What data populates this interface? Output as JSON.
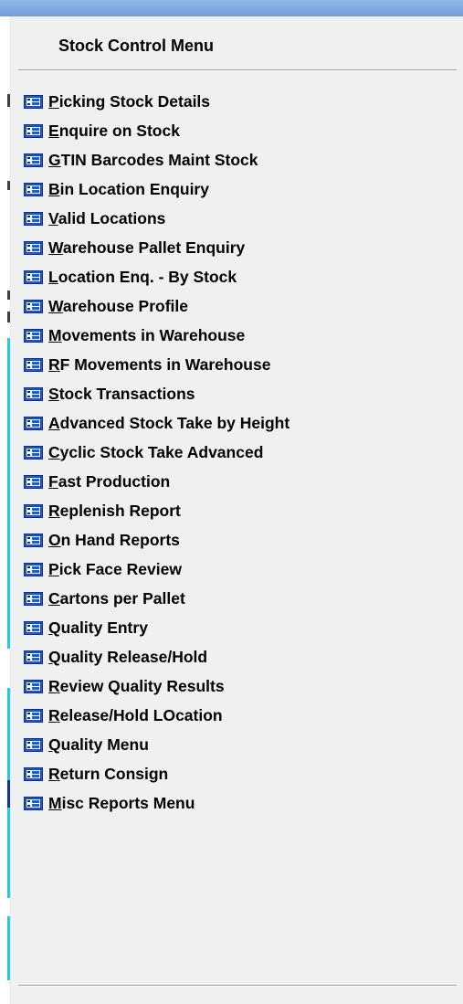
{
  "window": {
    "title_color": "#7aa7dd"
  },
  "menu": {
    "title": "Stock Control Menu",
    "icon": "menu-form-icon",
    "icon_colors": {
      "fill": "#1f5fbf",
      "frame": "#0b2f7a",
      "inner": "#ffffff"
    },
    "items": [
      {
        "first": "P",
        "rest": "icking Stock Details"
      },
      {
        "first": "E",
        "rest": "nquire on Stock"
      },
      {
        "first": "G",
        "rest": "TIN Barcodes Maint Stock"
      },
      {
        "first": "B",
        "rest": "in Location Enquiry"
      },
      {
        "first": "V",
        "rest": "alid Locations"
      },
      {
        "first": "W",
        "rest": "arehouse Pallet Enquiry"
      },
      {
        "first": "L",
        "rest": "ocation Enq. - By Stock"
      },
      {
        "first": "W",
        "rest": "arehouse Profile"
      },
      {
        "first": "M",
        "rest": "ovements in Warehouse"
      },
      {
        "first": "R",
        "rest": "F Movements in Warehouse"
      },
      {
        "first": "S",
        "rest": "tock Transactions"
      },
      {
        "first": "A",
        "rest": "dvanced Stock Take by Height"
      },
      {
        "first": "C",
        "rest": "yclic Stock Take Advanced"
      },
      {
        "first": "F",
        "rest": "ast Production"
      },
      {
        "first": "R",
        "rest": "eplenish Report"
      },
      {
        "first": "O",
        "rest": "n Hand Reports"
      },
      {
        "first": "P",
        "rest": "ick Face Review"
      },
      {
        "first": "C",
        "rest": "artons per Pallet"
      },
      {
        "first": "Q",
        "rest": "uality Entry"
      },
      {
        "first": "Q",
        "rest": "uality Release/Hold"
      },
      {
        "first": "R",
        "rest": "eview Quality Results"
      },
      {
        "first": "R",
        "rest": "elease/Hold LOcation"
      },
      {
        "first": "Q",
        "rest": "uality Menu"
      },
      {
        "first": "R",
        "rest": "eturn Consign"
      },
      {
        "first": "M",
        "rest": "isc Reports Menu"
      }
    ]
  }
}
